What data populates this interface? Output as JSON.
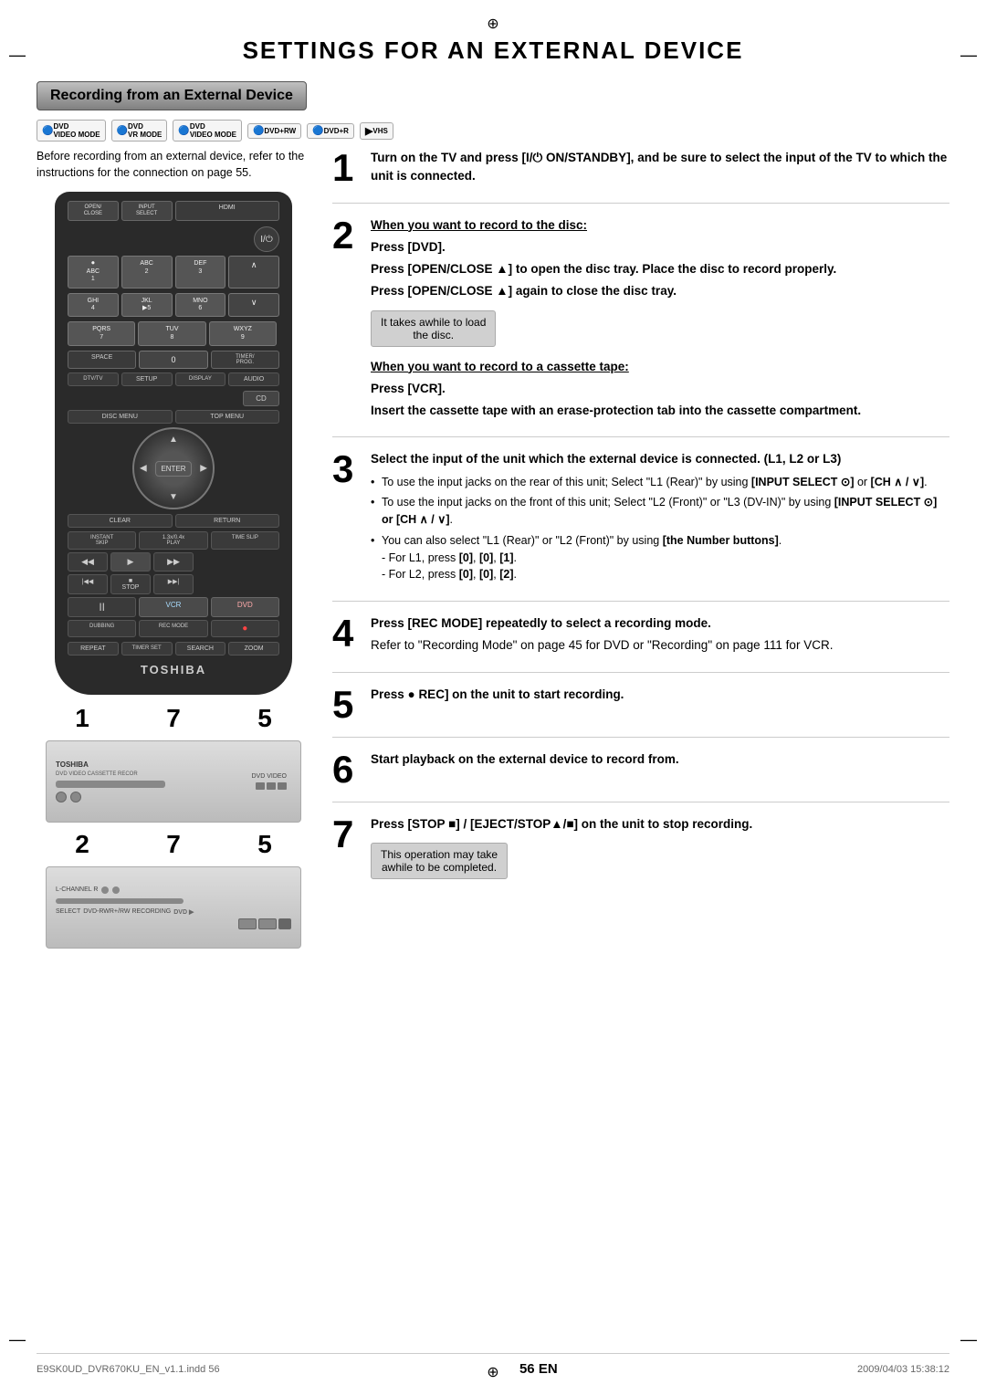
{
  "page": {
    "title": "SETTINGS FOR AN EXTERNAL DEVICE",
    "section_header": "Recording from an External Device",
    "footer_left": "E9SK0UD_DVR670KU_EN_v1.1.indd  56",
    "footer_right": "2009/04/03   15:38:12",
    "page_number": "56",
    "page_lang": "EN"
  },
  "format_icons": [
    "DVD VIDEO MODE",
    "DVD VR MODE",
    "DVD VIDEO MODE",
    "DVD +RW",
    "DVD +R",
    "VHS"
  ],
  "intro_text": "Before recording from an external device, refer to the instructions for the connection on page 55.",
  "remote": {
    "brand": "TOSHIBA",
    "buttons": {
      "open_close": "OPEN/ CLOSE",
      "input_select": "INPUT SELECT",
      "hdmi": "HDMI",
      "power": "I/⏻",
      "num1": "①",
      "num2": "2",
      "num3": "3",
      "num4": "4",
      "num5": "▶5",
      "num6": "6",
      "num7": "7",
      "num8": "8",
      "num9": "9",
      "num0": "0",
      "abc": "ABC",
      "def": "DEF",
      "ghi": "GHI",
      "jkl": "JKL",
      "mno": "MNO",
      "pqrs": "PQRS",
      "tuv": "TUV",
      "wxyz": "WXYZ",
      "ch_up": "CH ∧",
      "ch_dn": "CH ∨",
      "space": "SPACE",
      "timer_prog": "TIMER/ PROG.",
      "dtv_tv": "DTV/TV",
      "setup": "SETUP",
      "display": "DISPLAY",
      "audio": "AUDIO",
      "cd": "CD",
      "disc_menu": "DISC MENU",
      "top_menu": "TOP MENU",
      "clear": "CLEAR",
      "return": "RETURN",
      "instant_skip": "INSTANT SKIP",
      "play_1x": "1.3x/0.4x PLAY",
      "time_slip": "TIME SLIP",
      "rev": "REV",
      "play": "PLAY",
      "fwd": "FWD",
      "skip_prev": "◀◀|",
      "stop": "STOP",
      "skip_next": "|▶▶",
      "pause": "II",
      "vcr": "VCR",
      "dvd": "DVD",
      "dubbing": "DUBBING",
      "rec_mode": "REC MODE",
      "rec": "●",
      "repeat": "REPEAT",
      "timer_set": "TIMER SET",
      "search": "SEARCH",
      "zoom": "ZOOM"
    }
  },
  "callout_numbers_1": [
    "1",
    "7",
    "5"
  ],
  "callout_numbers_2": [
    "2",
    "7",
    "5"
  ],
  "steps": [
    {
      "num": "1",
      "content": [
        {
          "type": "bold",
          "text": "Turn on the TV and press [I/⏻ ON/STANDBY], and be sure to select the input of the TV to which the unit is connected."
        }
      ]
    },
    {
      "num": "2",
      "content": [
        {
          "type": "bold-underline",
          "text": "When you want to record to the disc:"
        },
        {
          "type": "bold",
          "text": "Press [DVD]."
        },
        {
          "type": "normal",
          "text": "Press [OPEN/CLOSE ▲] to open the disc tray. Place the disc to record properly."
        },
        {
          "type": "normal",
          "text": "Press [OPEN/CLOSE ▲] again to close the disc tray."
        },
        {
          "type": "note",
          "text": "It takes awhile to load the disc."
        },
        {
          "type": "bold-underline",
          "text": "When you want to record to a cassette tape:"
        },
        {
          "type": "bold",
          "text": "Press [VCR]."
        },
        {
          "type": "normal",
          "text": "Insert the cassette tape with an erase-protection tab into the cassette compartment."
        }
      ]
    },
    {
      "num": "3",
      "content": [
        {
          "type": "bold",
          "text": "Select the input of the unit which the external device is connected. (L1, L2 or L3)"
        },
        {
          "type": "bullet",
          "text": "To use the input jacks on the rear of this unit; Select \"L1 (Rear)\" by using [INPUT SELECT ⊙] or [CH ∧ / ∨]."
        },
        {
          "type": "bullet",
          "text": "To use the input jacks on the front of this unit; Select \"L2 (Front)\" or \"L3 (DV-IN)\" by using [INPUT SELECT ⊙] or [CH ∧ / ∨]."
        },
        {
          "type": "bullet",
          "text": "You can also select \"L1 (Rear)\" or \"L2 (Front)\" by using [the Number buttons]. - For L1, press [0], [0], [1]. - For L2, press [0], [0], [2]."
        }
      ]
    },
    {
      "num": "4",
      "content": [
        {
          "type": "bold",
          "text": "Press [REC MODE] repeatedly to select a recording mode."
        },
        {
          "type": "normal",
          "text": "Refer to \"Recording Mode\" on page 45 for DVD or \"Recording\" on page 111 for VCR."
        }
      ]
    },
    {
      "num": "5",
      "content": [
        {
          "type": "bold",
          "text": "Press ● REC] on the unit to start recording."
        }
      ]
    },
    {
      "num": "6",
      "content": [
        {
          "type": "bold",
          "text": "Start playback on the external device to record from."
        }
      ]
    },
    {
      "num": "7",
      "content": [
        {
          "type": "bold",
          "text": "Press [STOP ■] / [EJECT/STOP▲/■] on the unit to stop recording."
        },
        {
          "type": "note",
          "text": "This operation may take awhile to be completed."
        }
      ]
    }
  ]
}
